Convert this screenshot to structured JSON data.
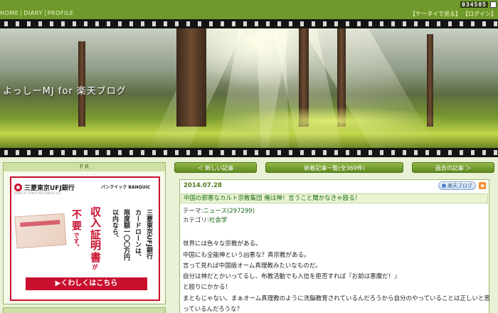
{
  "topnav": {
    "items": [
      "HOME",
      "DIARY",
      "PROFILE"
    ]
  },
  "counter": "034505",
  "toplinks": {
    "mobile": "【ケータイで見る】",
    "login": "【ログイン】"
  },
  "header": {
    "blog_title": "よっしーMJ for 楽天ブログ"
  },
  "sidebar": {
    "pr_label": "P R",
    "ad": {
      "bank_name": "三菱東京UFJ銀行",
      "bank_sub": "BANK OF TOKYO-MITSUBISHI UFJ",
      "product": "バンクイック BANQUIC",
      "col1": "三菱東京UFJ銀行",
      "col2": "カードローンは、",
      "col3": "限度額一〇〇万円",
      "col4": "以内なら、",
      "col5a": "不",
      "col5b": "要",
      "col5c": "です。",
      "col6a": "収入",
      "col6b": "証明",
      "col6c": "書",
      "col6d": "が",
      "button": "▶くわしくはこちら",
      "accent_color": "#c8102e"
    }
  },
  "nav": {
    "newer": "＜ 新しい記事",
    "list": "新着記事一覧(全369件)",
    "older": "過去の記事 ＞"
  },
  "article": {
    "date": "2014.07.28",
    "share_label": "楽天ブログ",
    "rss_icon": "rss-icon",
    "title": "中国の邪悪なカルト宗教集団 俺は神！言うこと聞かなきゃ殴る！",
    "theme_label": "テーマ:",
    "theme_link": "ニュース(297299)",
    "category_label": "カテゴリ:",
    "category_link": "社会学",
    "lines": [
      "世界には色々な宗教がある。",
      "中国にも全能神という凶悪な？真宗教がある。",
      "言って見れば中国版オーム真理教みたいなものだ。",
      "自分は神だとかいってるし、布教活動でも入信を拒否すれば『お前は悪魔だ！』",
      "と殴りにかかる！",
      "まともじゃない。まぁオーム真理教のように洗脳教育されているんだろうから自分のやっていることは正しいと思",
      "っているんだろうな？"
    ]
  }
}
